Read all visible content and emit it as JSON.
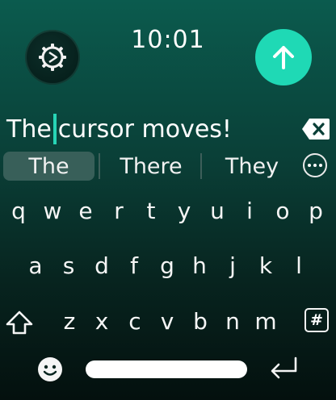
{
  "status": {
    "time": "10:01"
  },
  "input": {
    "before_cursor": "The",
    "after_cursor": "cursor moves!"
  },
  "suggestions": [
    "The",
    "There",
    "They"
  ],
  "keyboard": {
    "row1": [
      "q",
      "w",
      "e",
      "r",
      "t",
      "y",
      "u",
      "i",
      "o",
      "p"
    ],
    "row2": [
      "a",
      "s",
      "d",
      "f",
      "g",
      "h",
      "j",
      "k",
      "l"
    ],
    "row3": [
      "z",
      "x",
      "c",
      "v",
      "b",
      "n",
      "m"
    ],
    "symbols_key": "#"
  },
  "colors": {
    "accent": "#1fd9b5",
    "cursor": "#27d5b6",
    "selected_suggestion": "#385f59"
  },
  "icons": {
    "settings": "gear-icon",
    "send": "arrow-up-icon",
    "delete": "backspace-icon",
    "more": "more-options-icon",
    "shift": "shift-icon",
    "emoji": "emoji-icon",
    "return": "return-icon"
  }
}
